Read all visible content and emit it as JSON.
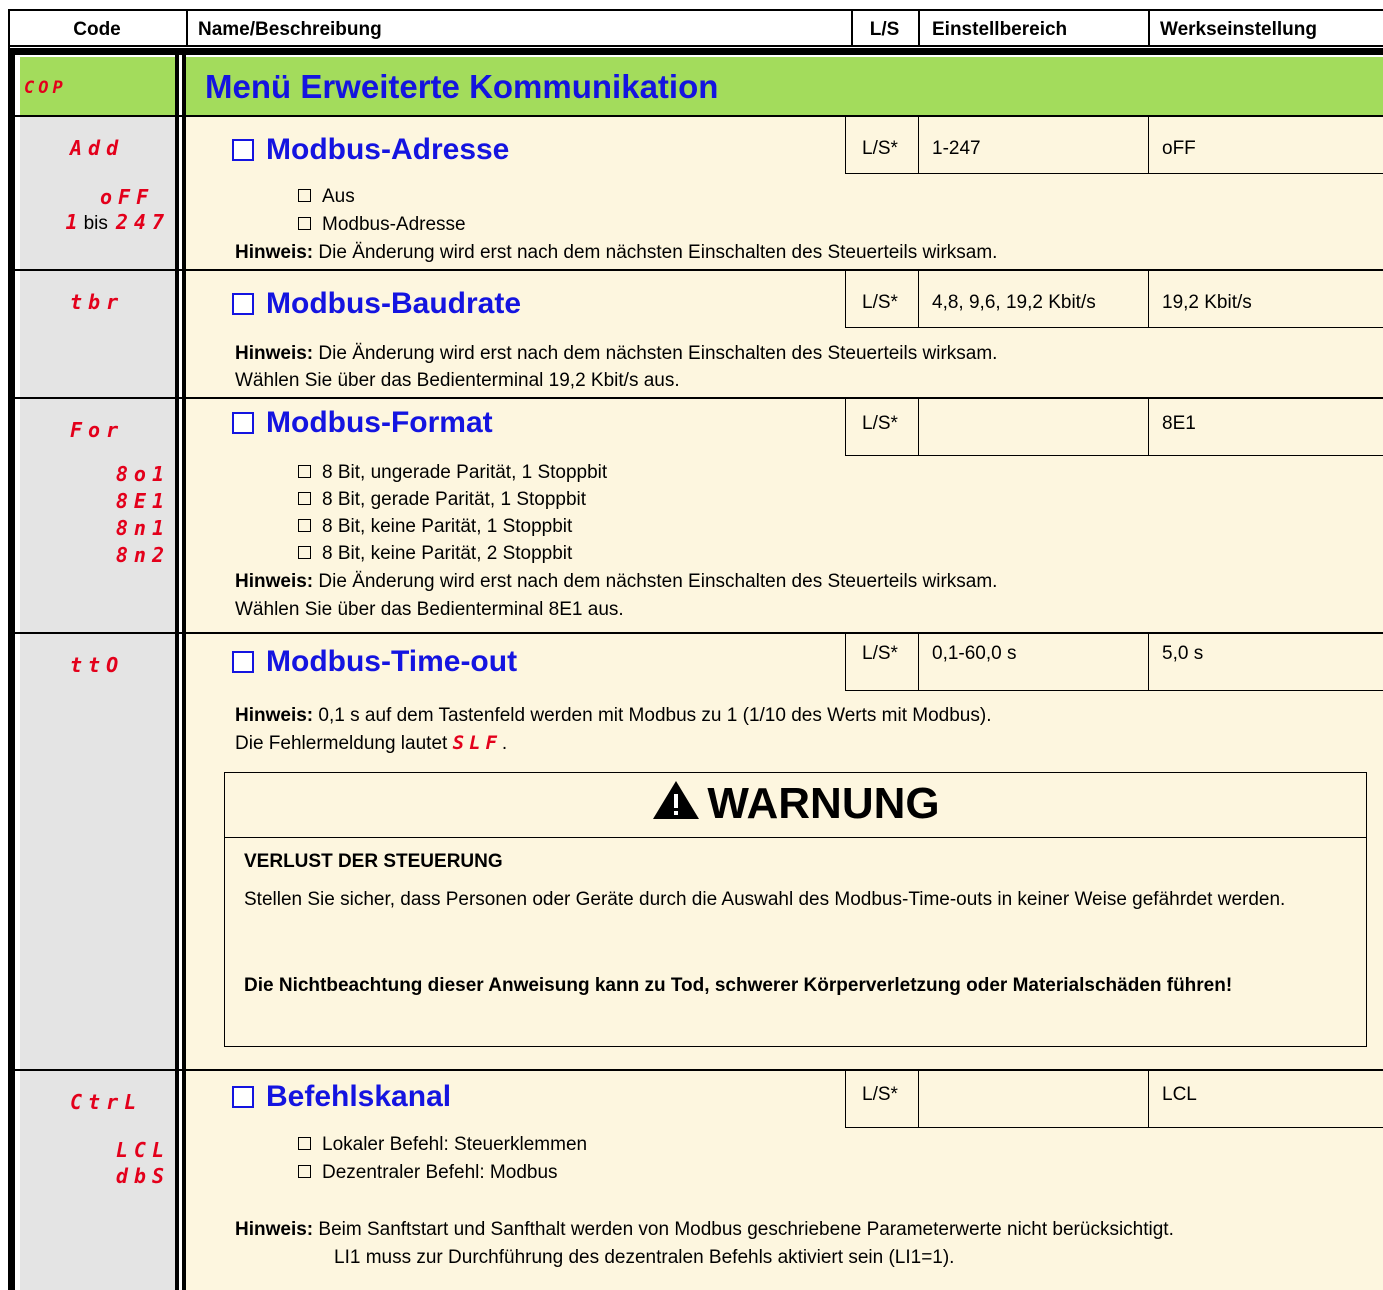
{
  "header": {
    "code": "Code",
    "name": "Name/Beschreibung",
    "ls": "L/S",
    "range": "Einstellbereich",
    "factory": "Werkseinstellung"
  },
  "menu": {
    "code": "COP",
    "title": "Menü Erweiterte Kommunikation"
  },
  "hint_label": "Hinweis:",
  "params": {
    "add": {
      "code": "Add",
      "title": "Modbus-Adresse",
      "ls": "L/S*",
      "range": "1-247",
      "factory": "oFF",
      "opt1_code": "oFF",
      "opt1_text": "Aus",
      "opt2_code_a": "1",
      "opt2_code_mid": "bis",
      "opt2_code_b": "247",
      "opt2_text": "Modbus-Adresse",
      "note": "Die Änderung wird erst nach dem nächsten Einschalten des Steuerteils wirksam."
    },
    "tbr": {
      "code": "tbr",
      "title": "Modbus-Baudrate",
      "ls": "L/S*",
      "range": "4,8, 9,6, 19,2 Kbit/s",
      "factory": "19,2 Kbit/s",
      "note": "Die Änderung wird erst nach dem nächsten Einschalten des Steuerteils wirksam.",
      "note2": "Wählen Sie über das Bedienterminal 19,2 Kbit/s aus."
    },
    "for": {
      "code": "For",
      "title": "Modbus-Format",
      "ls": "L/S*",
      "range": "",
      "factory": "8E1",
      "opts": [
        {
          "code": "8o1",
          "text": "8 Bit, ungerade Parität, 1 Stoppbit"
        },
        {
          "code": "8E1",
          "text": "8 Bit, gerade Parität, 1 Stoppbit"
        },
        {
          "code": "8n1",
          "text": "8 Bit, keine Parität, 1 Stoppbit"
        },
        {
          "code": "8n2",
          "text": "8 Bit, keine Parität, 2 Stoppbit"
        }
      ],
      "note": "Die Änderung wird erst nach dem nächsten Einschalten des Steuerteils wirksam.",
      "note2": "Wählen Sie über das Bedienterminal 8E1 aus."
    },
    "tto": {
      "code": "ttO",
      "title": "Modbus-Time-out",
      "ls": "L/S*",
      "range": "0,1-60,0 s",
      "factory": "5,0 s",
      "note": "0,1 s auf dem Tastenfeld werden mit Modbus zu 1 (1/10 des Werts mit Modbus).",
      "note2_pre": "Die Fehlermeldung lautet",
      "note2_code": "SLF",
      "note2_post": "."
    },
    "ctrl": {
      "code": "CtrL",
      "title": "Befehlskanal",
      "ls": "L/S*",
      "range": "",
      "factory": "LCL",
      "opt1_code": "LCL",
      "opt1_text": "Lokaler Befehl: Steuerklemmen",
      "opt2_code": "dbS",
      "opt2_text": "Dezentraler Befehl: Modbus",
      "note": "Beim Sanftstart und Sanfthalt werden von Modbus geschriebene Parameterwerte nicht berücksichtigt.",
      "note2": "LI1 muss zur Durchführung des dezentralen Befehls aktiviert sein (LI1=1)."
    }
  },
  "warning": {
    "title": "WARNUNG",
    "subtitle": "VERLUST DER STEUERUNG",
    "body": "Stellen Sie sicher, dass Personen oder Geräte durch die Auswahl des Modbus-Time-outs in keiner Weise gefährdet werden.",
    "consequence": "Die Nichtbeachtung dieser Anweisung kann zu Tod, schwerer Körperverletzung oder Materialschäden führen!"
  },
  "colors": {
    "menu_bg": "#a3dc5c",
    "code_bg": "#e4e4e4",
    "content_bg": "#fdf6df",
    "title_blue": "#1414e0",
    "code_red": "#e3001b"
  }
}
